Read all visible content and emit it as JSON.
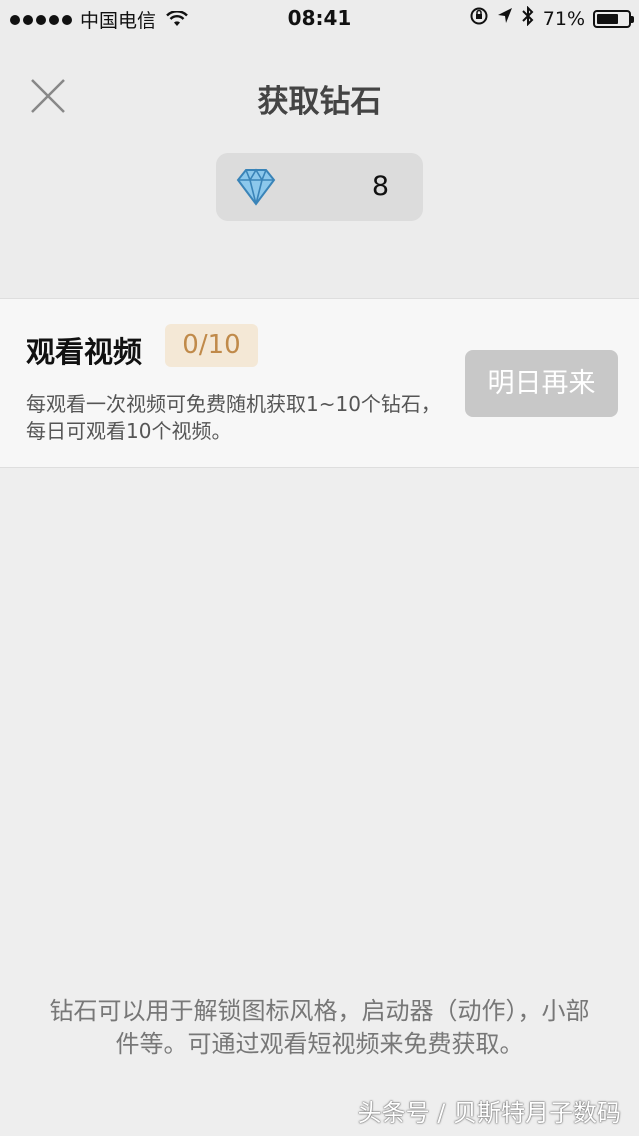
{
  "status_bar": {
    "carrier": "中国电信",
    "time": "08:41",
    "battery": "71%",
    "battery_level": 0.71
  },
  "header": {
    "title": "获取钻石",
    "diamond_count": "8"
  },
  "task": {
    "title": "观看视频",
    "progress": "0/10",
    "description": "每观看一次视频可免费随机获取1~10个钻石，每日可观看10个视频。",
    "button_label": "明日再来"
  },
  "footer": {
    "note": "钻石可以用于解锁图标风格，启动器（动作），小部件等。可通过观看短视频来免费获取。"
  },
  "watermark": "头条号 / 贝斯特月子数码",
  "colors": {
    "background": "#eeeeee",
    "progress_badge_bg": "#f4e8d6",
    "progress_text": "#c08a4a",
    "disabled_button": "#c8c8c8",
    "diamond": "#5aa7d6"
  }
}
